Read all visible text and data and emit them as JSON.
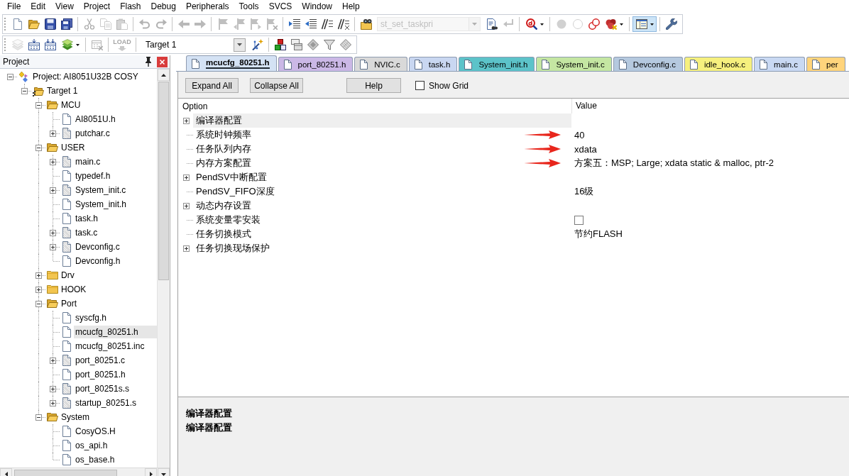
{
  "menu_bar": [
    "File",
    "Edit",
    "View",
    "Project",
    "Flash",
    "Debug",
    "Peripherals",
    "Tools",
    "SVCS",
    "Window",
    "Help"
  ],
  "toolbar_1": {
    "buttons": [
      {
        "disabled": false,
        "pressed": false
      },
      {
        "disabled": false,
        "pressed": false
      },
      {
        "disabled": false,
        "pressed": false
      },
      {
        "disabled": false,
        "pressed": false
      },
      {
        "disabled": true,
        "pressed": false
      },
      {
        "disabled": true,
        "pressed": false
      },
      {
        "disabled": true,
        "pressed": false
      },
      {
        "disabled": true,
        "pressed": false
      },
      {
        "disabled": true,
        "pressed": false
      },
      {
        "disabled": true,
        "pressed": false
      },
      {
        "disabled": true,
        "pressed": false
      },
      {
        "disabled": true,
        "pressed": false
      },
      {
        "disabled": true,
        "pressed": false
      },
      {
        "disabled": true,
        "pressed": false
      },
      {
        "disabled": true,
        "pressed": false
      },
      {
        "disabled": false,
        "pressed": false
      },
      {
        "disabled": false,
        "pressed": false
      },
      {
        "disabled": false,
        "pressed": false
      },
      {
        "disabled": false,
        "pressed": false
      },
      {
        "disabled": false,
        "pressed": false
      },
      {
        "disabled": false,
        "pressed": false
      },
      {
        "disabled": true,
        "pressed": false
      },
      {
        "disabled": false,
        "pressed": false
      },
      {
        "disabled": true,
        "pressed": false
      },
      {
        "disabled": true,
        "pressed": false
      },
      {
        "disabled": false,
        "pressed": false
      },
      {
        "disabled": false,
        "pressed": false
      },
      {
        "disabled": false,
        "pressed": true
      },
      {
        "disabled": false,
        "pressed": false
      }
    ],
    "function_box": {
      "value": "st_set_taskpri",
      "disabled": true
    }
  },
  "toolbar_2": {
    "buttons": [
      {
        "disabled": true,
        "pressed": false
      },
      {
        "disabled": false,
        "pressed": false
      },
      {
        "disabled": false,
        "pressed": false
      },
      {
        "disabled": false,
        "pressed": false
      },
      {
        "disabled": true,
        "pressed": false
      },
      {
        "label": "LOAD",
        "disabled": true,
        "pressed": false
      },
      {
        "disabled": false,
        "pressed": false
      },
      {
        "disabled": false,
        "pressed": false
      },
      {
        "disabled": false,
        "pressed": false
      },
      {
        "disabled": false,
        "pressed": false
      },
      {
        "disabled": false,
        "pressed": false
      },
      {
        "disabled": false,
        "pressed": false
      }
    ],
    "target_box": {
      "value": "Target 1",
      "disabled": false
    }
  },
  "project_panel": {
    "title": "Project",
    "tree": [
      {
        "label": "Project: AI8051U32B COSY",
        "kind": "project",
        "expanded": true,
        "selected": false,
        "children": [
          {
            "label": "Target 1",
            "kind": "target",
            "expanded": true,
            "selected": false,
            "children": [
              {
                "label": "MCU",
                "kind": "folder",
                "expanded": true,
                "selected": false,
                "children": [
                  {
                    "label": "AI8051U.h",
                    "kind": "file",
                    "selected": false
                  },
                  {
                    "label": "putchar.c",
                    "kind": "source",
                    "expanded": false,
                    "selected": false
                  }
                ]
              },
              {
                "label": "USER",
                "kind": "folder",
                "expanded": true,
                "selected": false,
                "children": [
                  {
                    "label": "main.c",
                    "kind": "source",
                    "expanded": false,
                    "selected": false
                  },
                  {
                    "label": "typedef.h",
                    "kind": "file",
                    "selected": false
                  },
                  {
                    "label": "System_init.c",
                    "kind": "source",
                    "expanded": false,
                    "selected": false
                  },
                  {
                    "label": "System_init.h",
                    "kind": "file",
                    "selected": false
                  },
                  {
                    "label": "task.h",
                    "kind": "file",
                    "selected": false
                  },
                  {
                    "label": "task.c",
                    "kind": "source",
                    "expanded": false,
                    "selected": false
                  },
                  {
                    "label": "Devconfig.c",
                    "kind": "source",
                    "expanded": false,
                    "selected": false
                  },
                  {
                    "label": "Devconfig.h",
                    "kind": "file",
                    "selected": false
                  }
                ]
              },
              {
                "label": "Drv",
                "kind": "folder",
                "expanded": false,
                "selected": false
              },
              {
                "label": "HOOK",
                "kind": "folder",
                "expanded": false,
                "selected": false
              },
              {
                "label": "Port",
                "kind": "folder",
                "expanded": true,
                "selected": false,
                "children": [
                  {
                    "label": "syscfg.h",
                    "kind": "file",
                    "selected": false
                  },
                  {
                    "label": "mcucfg_80251.h",
                    "kind": "file",
                    "selected": true
                  },
                  {
                    "label": "mcucfg_80251.inc",
                    "kind": "file",
                    "selected": false
                  },
                  {
                    "label": "port_80251.c",
                    "kind": "source",
                    "expanded": false,
                    "selected": false
                  },
                  {
                    "label": "port_80251.h",
                    "kind": "file",
                    "selected": false
                  },
                  {
                    "label": "port_80251s.s",
                    "kind": "source",
                    "expanded": false,
                    "selected": false
                  },
                  {
                    "label": "startup_80251.s",
                    "kind": "source",
                    "expanded": false,
                    "selected": false
                  }
                ]
              },
              {
                "label": "System",
                "kind": "folder",
                "expanded": true,
                "selected": false,
                "children": [
                  {
                    "label": "CosyOS.H",
                    "kind": "file",
                    "selected": false
                  },
                  {
                    "label": "os_api.h",
                    "kind": "file",
                    "selected": false
                  },
                  {
                    "label": "os_base.h",
                    "kind": "file",
                    "selected": false
                  }
                ]
              }
            ]
          }
        ]
      }
    ]
  },
  "tabs": [
    {
      "label": "mcucfg_80251.h",
      "selected": true,
      "color": "#d4e2f4"
    },
    {
      "label": "port_80251.h",
      "selected": false,
      "color": "#cbb8e6"
    },
    {
      "label": "NVIC.c",
      "selected": false,
      "color": "#d9d9d9"
    },
    {
      "label": "task.h",
      "selected": false,
      "color": "#c9d7f1"
    },
    {
      "label": "System_init.h",
      "selected": false,
      "color": "#5cc3c9"
    },
    {
      "label": "System_init.c",
      "selected": false,
      "color": "#c4e6a2"
    },
    {
      "label": "Devconfig.c",
      "selected": false,
      "color": "#b5c9df"
    },
    {
      "label": "idle_hook.c",
      "selected": false,
      "color": "#f6f07e"
    },
    {
      "label": "main.c",
      "selected": false,
      "color": "#c9d9f3"
    },
    {
      "label": "per",
      "selected": false,
      "color": "#ffd47c"
    }
  ],
  "option_page": {
    "buttons": [
      "Expand All",
      "Collapse All",
      "Help"
    ],
    "show_grid": {
      "label": "Show Grid",
      "checked": false
    },
    "columns": [
      "Option",
      "Value"
    ],
    "rows": [
      {
        "kind": "group",
        "option": "编译器配置",
        "expanded": false,
        "selected": true,
        "marked": false
      },
      {
        "kind": "text",
        "option": "系统时钟频率",
        "value": "40",
        "selected": false,
        "marked": true
      },
      {
        "kind": "text",
        "option": "任务队列内存",
        "value": "xdata",
        "selected": false,
        "marked": true
      },
      {
        "kind": "text",
        "option": "内存方案配置",
        "value": "方案五：MSP; Large; xdata static & malloc, ptr-2",
        "selected": false,
        "marked": true
      },
      {
        "kind": "group",
        "option": "PendSV中断配置",
        "expanded": false,
        "selected": false,
        "marked": false
      },
      {
        "kind": "text",
        "option": "PendSV_FIFO深度",
        "value": "16级",
        "selected": false,
        "marked": false
      },
      {
        "kind": "group",
        "option": "动态内存设置",
        "expanded": false,
        "selected": false,
        "marked": false
      },
      {
        "kind": "checkbox",
        "option": "系统变量零安装",
        "checked": false,
        "selected": false,
        "marked": false
      },
      {
        "kind": "text",
        "option": "任务切换模式",
        "value": "节约FLASH",
        "selected": false,
        "marked": false
      },
      {
        "kind": "group",
        "option": "任务切换现场保护",
        "expanded": false,
        "selected": false,
        "marked": false
      }
    ],
    "description": [
      "编译器配置",
      "编译器配置"
    ]
  }
}
